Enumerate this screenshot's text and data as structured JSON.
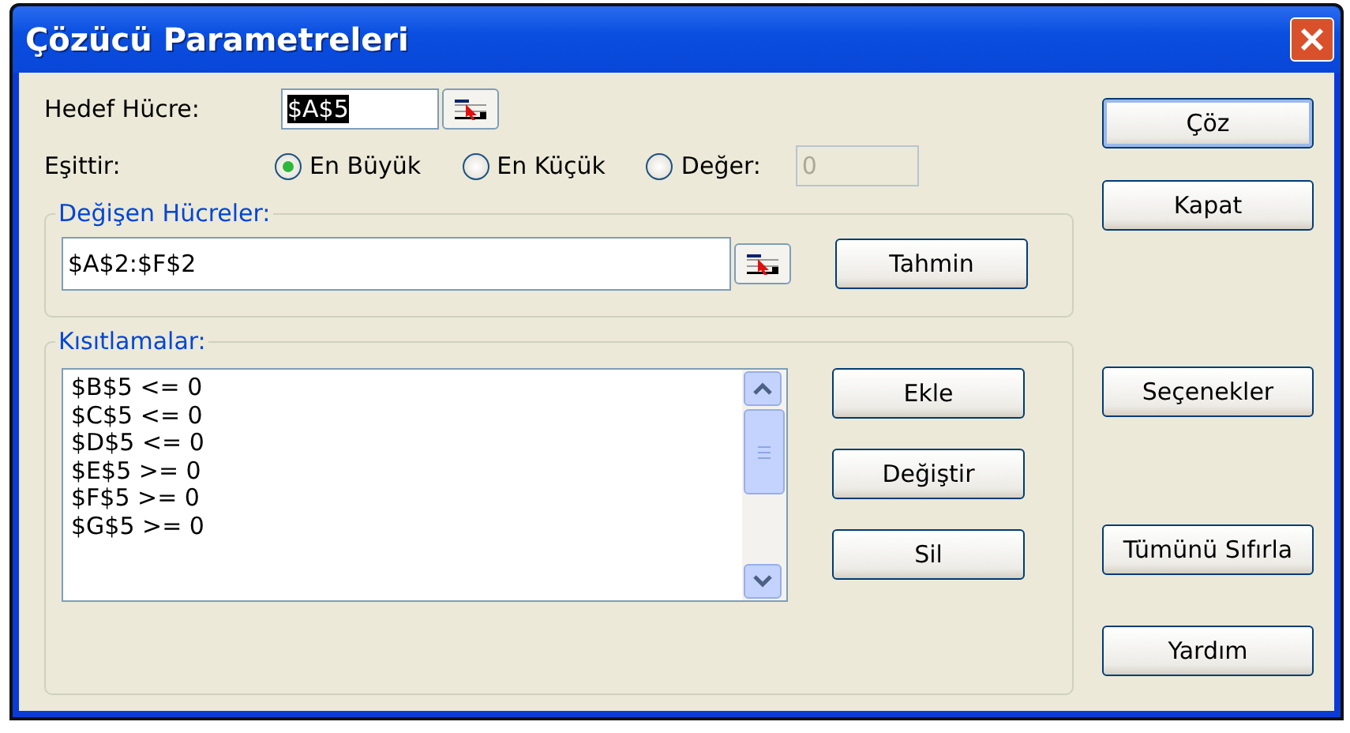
{
  "window": {
    "title": "Çözücü Parametreleri"
  },
  "target_cell": {
    "label": "Hedef Hücre:",
    "value": "$A$5",
    "highlighted": true
  },
  "equals": {
    "label": "Eşittir:",
    "options": [
      {
        "label": "En Büyük",
        "selected": true
      },
      {
        "label": "En Küçük",
        "selected": false
      },
      {
        "label": "Değer:",
        "selected": false
      }
    ],
    "value_field": {
      "value": "0",
      "disabled": true
    }
  },
  "changing_cells": {
    "label": "Değişen Hücreler:",
    "value": "$A$2:$F$2",
    "button": "Tahmin"
  },
  "constraints": {
    "label": "Kısıtlamalar:",
    "items": [
      "$B$5 <= 0",
      "$C$5 <= 0",
      "$D$5 <= 0",
      "$E$5 >= 0",
      "$F$5 >= 0",
      "$G$5 >= 0"
    ],
    "buttons": [
      "Ekle",
      "Değiştir",
      "Sil"
    ]
  },
  "side_buttons": [
    {
      "label": "Çöz",
      "default": true,
      "kind": "top"
    },
    {
      "label": "Kapat",
      "default": false,
      "kind": "top"
    },
    {
      "label": "Seçenekler",
      "default": false,
      "kind": "middle"
    },
    {
      "label": "Tümünü Sıfırla",
      "default": false,
      "kind": "bottom"
    },
    {
      "label": "Yardım",
      "default": false,
      "kind": "bottom"
    }
  ]
}
